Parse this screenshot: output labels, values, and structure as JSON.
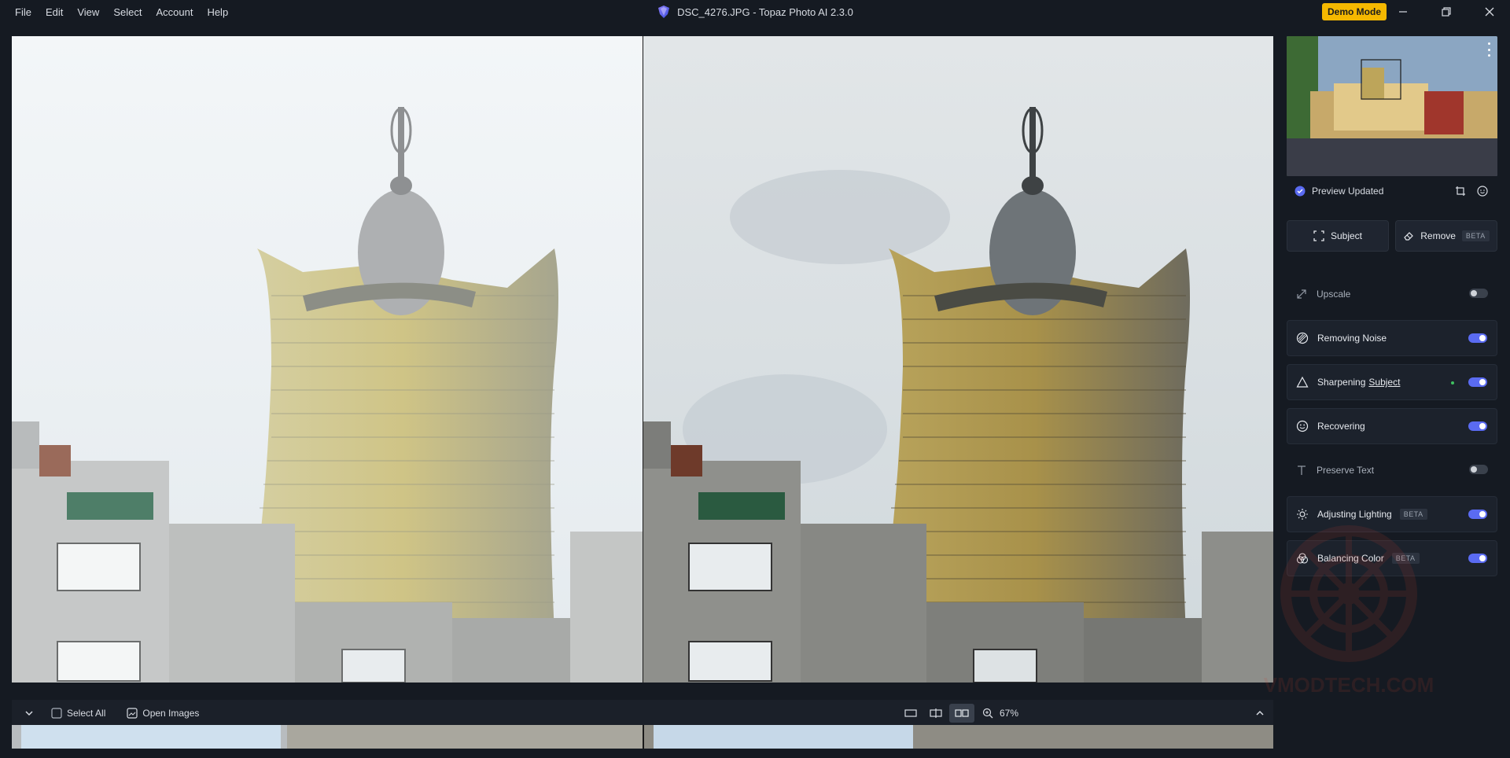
{
  "menu": [
    "File",
    "Edit",
    "View",
    "Select",
    "Account",
    "Help"
  ],
  "window": {
    "title": "DSC_4276.JPG - Topaz Photo AI 2.3.0",
    "demo_label": "Demo Mode"
  },
  "bottom": {
    "select_all": "Select All",
    "open_images": "Open Images",
    "zoom": "67%"
  },
  "sidebar": {
    "preview_status": "Preview Updated",
    "subject_btn": "Subject",
    "remove_btn": "Remove",
    "beta": "BETA",
    "features": [
      {
        "label": "Upscale",
        "enabled": false
      },
      {
        "label": "Removing Noise",
        "enabled": true
      },
      {
        "label": "Sharpening",
        "sublabel": "Subject",
        "enabled": true
      },
      {
        "label": "Recovering",
        "enabled": true
      },
      {
        "label": "Preserve Text",
        "enabled": false
      },
      {
        "label": "Adjusting Lighting",
        "beta": "BETA",
        "enabled": true
      },
      {
        "label": "Balancing Color",
        "beta": "BETA",
        "enabled": true
      }
    ]
  },
  "watermark": "VMODTECH.COM",
  "colors": {
    "accent": "#5a6bf2",
    "demo": "#f5b800",
    "background": "#151a22"
  }
}
